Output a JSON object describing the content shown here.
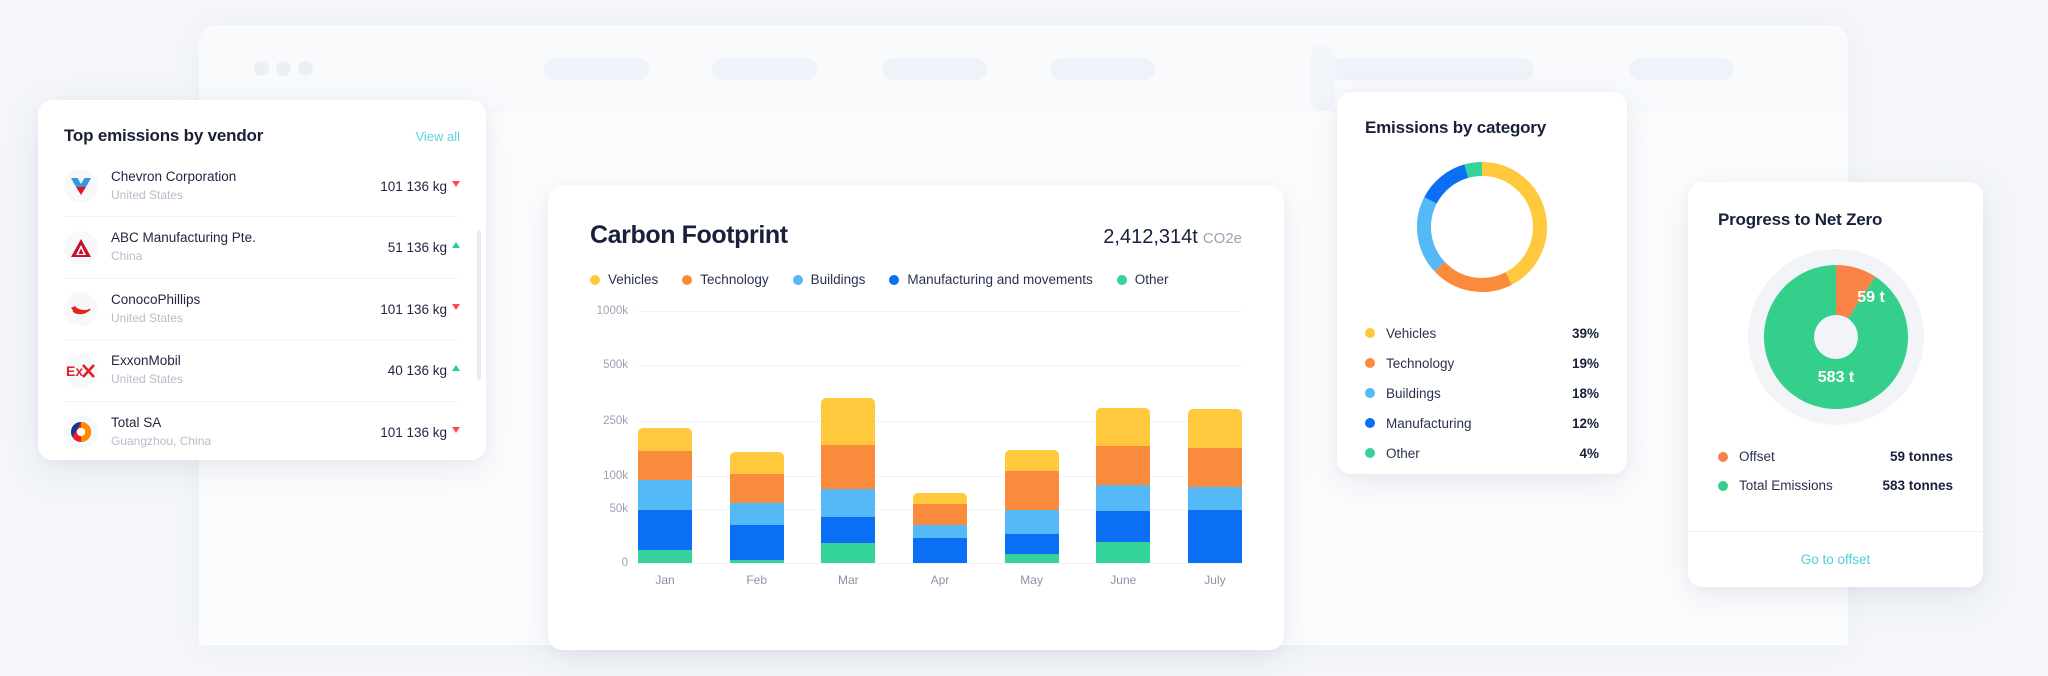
{
  "colors": {
    "vehicles": "#ffc83d",
    "technology": "#fb8b3c",
    "buildings": "#55b9f7",
    "manufacturing": "#0a6ff5",
    "other": "#34d399",
    "offset": "#f98246",
    "total_emissions": "#34d08b",
    "link": "#5ed4dd",
    "up": "#2ecc8f",
    "down": "#ff4d4f"
  },
  "vendor_card": {
    "title": "Top emissions by vendor",
    "view_all": "View all",
    "rows": [
      {
        "name": "Chevron Corporation",
        "country": "United States",
        "value": "101 136 kg",
        "trend": "down",
        "logo": "chevron-logo"
      },
      {
        "name": "ABC Manufacturing Pte.",
        "country": "China",
        "value": "51 136 kg",
        "trend": "up",
        "logo": "abc-manufacturing-logo"
      },
      {
        "name": "ConocoPhillips",
        "country": "United States",
        "value": "101 136 kg",
        "trend": "down",
        "logo": "conocophillips-logo"
      },
      {
        "name": "ExxonMobil",
        "country": "United States",
        "value": "40 136 kg",
        "trend": "up",
        "logo": "exxonmobil-logo"
      },
      {
        "name": "Total SA",
        "country": "Guangzhou, China",
        "value": "101 136 kg",
        "trend": "down",
        "logo": "total-sa-logo"
      }
    ]
  },
  "footprint_card": {
    "title": "Carbon Footprint",
    "total_value": "2,412,314t",
    "total_unit": "CO2e"
  },
  "category_card": {
    "title": "Emissions by category"
  },
  "netzero_card": {
    "title": "Progress to Net Zero",
    "center_offset_label": "59 t",
    "center_total_label": "583 t",
    "go_to_offset": "Go to offset",
    "legend": [
      {
        "label": "Offset",
        "value": "59 tonnes",
        "color": "#f98246"
      },
      {
        "label": "Total Emissions",
        "value": "583 tonnes",
        "color": "#34d08b"
      }
    ]
  },
  "chart_data": [
    {
      "id": "carbon-footprint",
      "type": "bar",
      "stacked": true,
      "title": "Carbon Footprint",
      "xlabel": "",
      "ylabel": "",
      "categories": [
        "Jan",
        "Feb",
        "Mar",
        "Apr",
        "May",
        "June",
        "July"
      ],
      "ytick_labels": [
        "0",
        "50k",
        "100k",
        "250k",
        "500k",
        "1000k"
      ],
      "ytick_values": [
        0,
        50000,
        100000,
        250000,
        500000,
        1000000
      ],
      "ylim": [
        0,
        1000000
      ],
      "grid": true,
      "legend_position": "top",
      "series": [
        {
          "name": "Other",
          "color": "#34d399",
          "values": [
            22000,
            5000,
            42000,
            0,
            14000,
            42000,
            0
          ]
        },
        {
          "name": "Manufacturing and movements",
          "color": "#0a6ff5",
          "values": [
            68000,
            52000,
            56000,
            26000,
            30000,
            62000,
            104000
          ]
        },
        {
          "name": "Buildings",
          "color": "#55b9f7",
          "values": [
            52000,
            33000,
            60000,
            14000,
            36000,
            50000,
            46000
          ]
        },
        {
          "name": "Technology",
          "color": "#fb8b3c",
          "values": [
            48000,
            42000,
            92000,
            22000,
            58000,
            78000,
            76000
          ]
        },
        {
          "name": "Vehicles",
          "color": "#ffc83d",
          "values": [
            40000,
            34000,
            100000,
            12000,
            32000,
            76000,
            76000
          ]
        }
      ]
    },
    {
      "id": "emissions-by-category",
      "type": "pie",
      "donut": true,
      "title": "Emissions by category",
      "labels": [
        "Vehicles",
        "Technology",
        "Buildings",
        "Manufacturing",
        "Other"
      ],
      "values": [
        39,
        19,
        18,
        12,
        4
      ],
      "display_values": [
        "39%",
        "19%",
        "18%",
        "12%",
        "4%"
      ],
      "colors": [
        "#ffc83d",
        "#fb8b3c",
        "#55b9f7",
        "#0a6ff5",
        "#34d399"
      ],
      "legend_position": "bottom"
    },
    {
      "id": "progress-to-net-zero",
      "type": "pie",
      "donut": true,
      "title": "Progress to Net Zero",
      "labels": [
        "Offset",
        "Total Emissions"
      ],
      "values": [
        59,
        583
      ],
      "display_values": [
        "59 t",
        "583 t"
      ],
      "unit": "tonnes",
      "colors": [
        "#f98246",
        "#34d08b"
      ],
      "legend_position": "bottom"
    }
  ]
}
